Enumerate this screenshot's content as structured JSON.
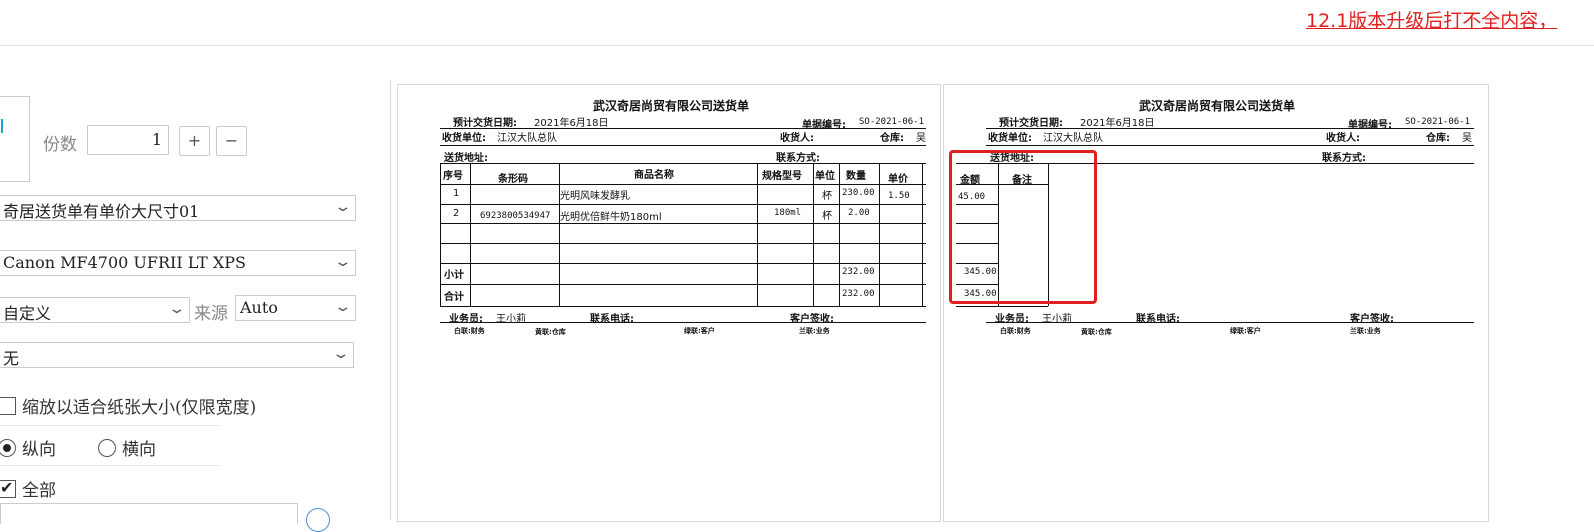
{
  "notice": {
    "text": "12.1版本升级后打不全内容，"
  },
  "settings": {
    "copies_label": "份数",
    "copies_value": "1",
    "plus_label": "+",
    "minus_label": "−",
    "template_select": "奇居送货单有单价大尺寸01",
    "printer_select": "Canon MF4700 UFRII LT XPS",
    "paper_select": "自定义",
    "source_label": "来源",
    "source_select": "Auto",
    "duplex_select": "无",
    "scale_label": "缩放以适合纸张大小(仅限宽度)",
    "portrait_label": "纵向",
    "landscape_label": "横向",
    "all_label": "全部",
    "scale_checked": false,
    "orientation": "portrait",
    "all_checked": true
  },
  "doc": {
    "title": "武汉奇居尚贸有限公司送货单",
    "delivery_date_label": "预计交货日期:",
    "delivery_date": "2021年6月18日",
    "doc_no_label": "单据编号:",
    "doc_no": "SO-2021-06-1",
    "receiver_unit_label": "收货单位:",
    "receiver_unit": "江汉大队总队",
    "receiver_label": "收货人:",
    "warehouse_label": "仓库:",
    "warehouse": "吴",
    "address_label": "送货地址:",
    "contact_label": "联系方式:",
    "columns": [
      "序号",
      "条形码",
      "商品名称",
      "规格型号",
      "单位",
      "数量",
      "单价"
    ],
    "rows": [
      {
        "no": "1",
        "barcode": "",
        "name": "光明风味发酵乳",
        "spec": "",
        "unit": "杯",
        "qty": "230.00",
        "price": "1.50"
      },
      {
        "no": "2",
        "barcode": "6923800534947",
        "name": "光明优倍鲜牛奶180ml",
        "spec": "180ml",
        "unit": "杯",
        "qty": "2.00",
        "price": ""
      }
    ],
    "subtotal_label": "小计",
    "subtotal_qty": "232.00",
    "total_label": "合计",
    "total_qty": "232.00",
    "salesman_label": "业务员:",
    "salesman": "王小莉",
    "phone_label": "联系电话:",
    "signature_label": "客户签收:",
    "footer_notes": [
      "白联:财务",
      "黄联:仓库",
      "绿联:客户",
      "兰联:业务"
    ]
  },
  "doc2": {
    "amount_label": "金额",
    "remark_label": "备注",
    "row1_amount": "45.00",
    "subtotal_amount": "345.00",
    "total_amount": "345.00"
  }
}
